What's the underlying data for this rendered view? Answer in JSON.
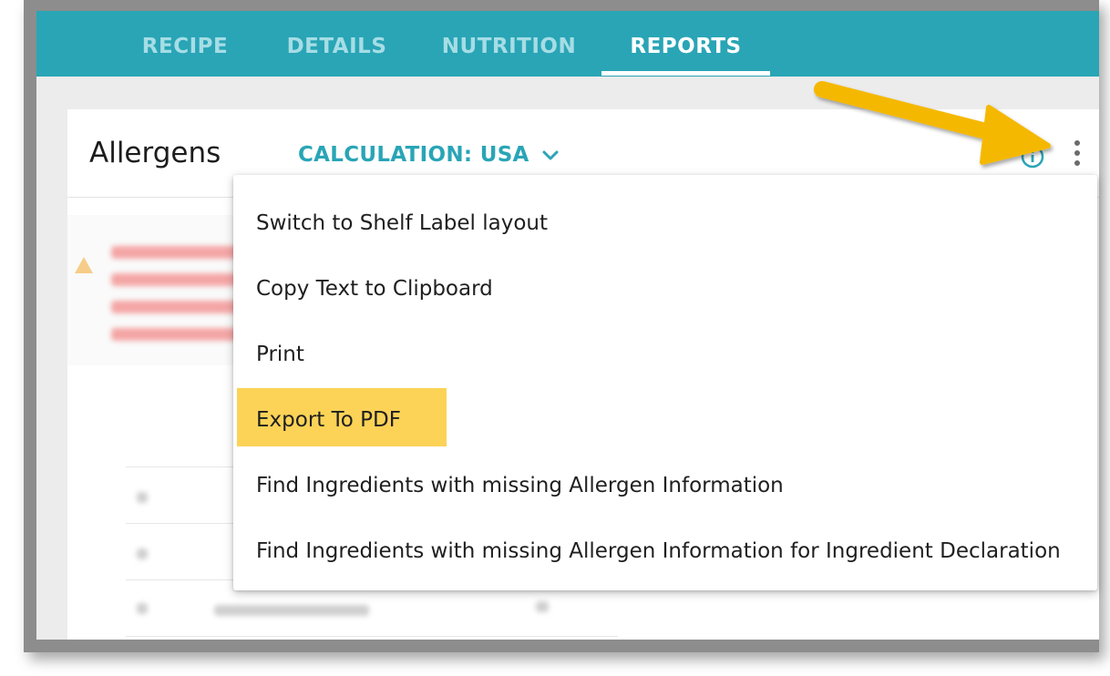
{
  "tabs": [
    {
      "label": "RECIPE",
      "active": false
    },
    {
      "label": "DETAILS",
      "active": false
    },
    {
      "label": "NUTRITION",
      "active": false
    },
    {
      "label": "REPORTS",
      "active": true
    }
  ],
  "card": {
    "title": "Allergens",
    "calculation_label": "CALCULATION: USA"
  },
  "menu": {
    "items": [
      {
        "label": "Switch to Shelf Label layout"
      },
      {
        "label": "Copy Text to Clipboard"
      },
      {
        "label": "Print"
      },
      {
        "label": "Export To PDF",
        "highlighted": true
      },
      {
        "label": "Find Ingredients with missing Allergen Information"
      },
      {
        "label": "Find Ingredients with missing Allergen Information for Ingredient Declaration"
      }
    ]
  },
  "icons": {
    "info": "info-icon",
    "more": "kebab-menu-icon",
    "dropdown": "chevron-down-icon",
    "warning": "warning-icon",
    "annotation": "arrow-icon"
  },
  "colors": {
    "accent": "#29a5b6",
    "highlight": "#fcd357",
    "arrow": "#f5b800",
    "warning_text": "#e23c3c"
  }
}
